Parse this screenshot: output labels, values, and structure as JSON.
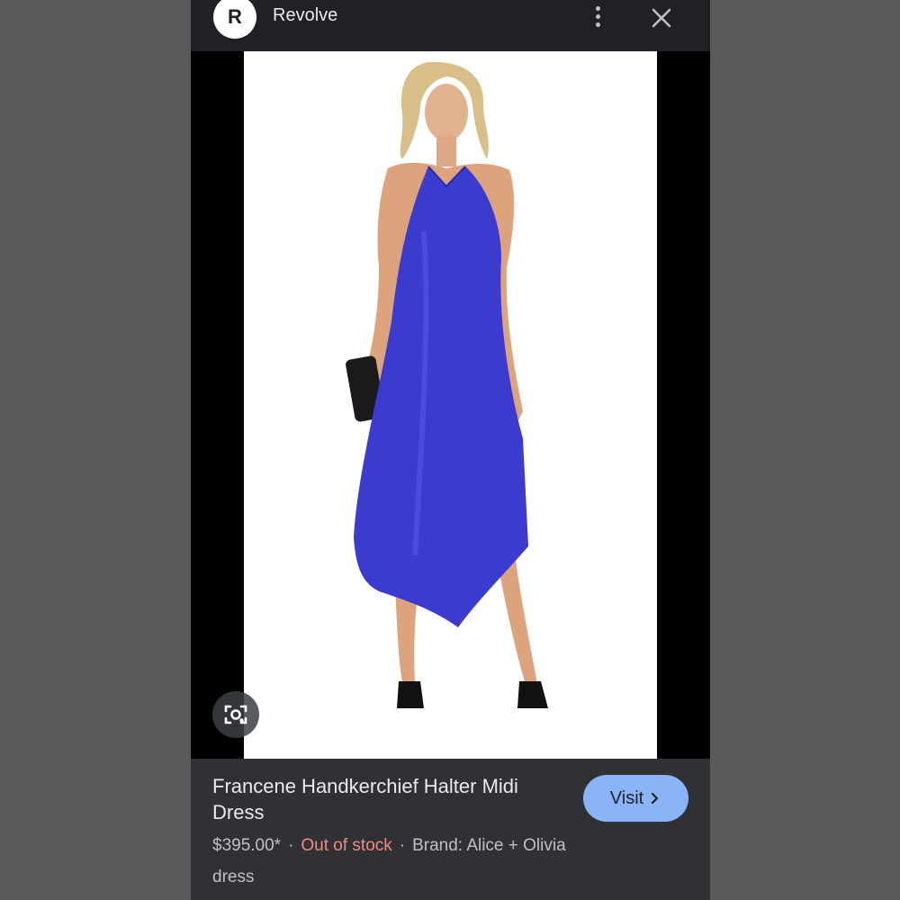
{
  "header": {
    "logo_letter": "R",
    "site_name": "Revolve",
    "more_icon": "more-vert-icon",
    "close_icon": "close-icon"
  },
  "image": {
    "lens_icon": "lens-search-icon",
    "dress_color": "#3b3ccf"
  },
  "product": {
    "title": "Francene Handkerchief Halter Midi Dress",
    "visit_label": "Visit",
    "visit_icon": "chevron-right-icon",
    "price": "$395.00*",
    "separator": "·",
    "stock_status": "Out of stock",
    "brand": "Brand: Alice + Olivia",
    "category": "dress"
  },
  "colors": {
    "visit_button": "#8ab4f8",
    "stock_status": "#f28b82",
    "panel": "#303134"
  }
}
